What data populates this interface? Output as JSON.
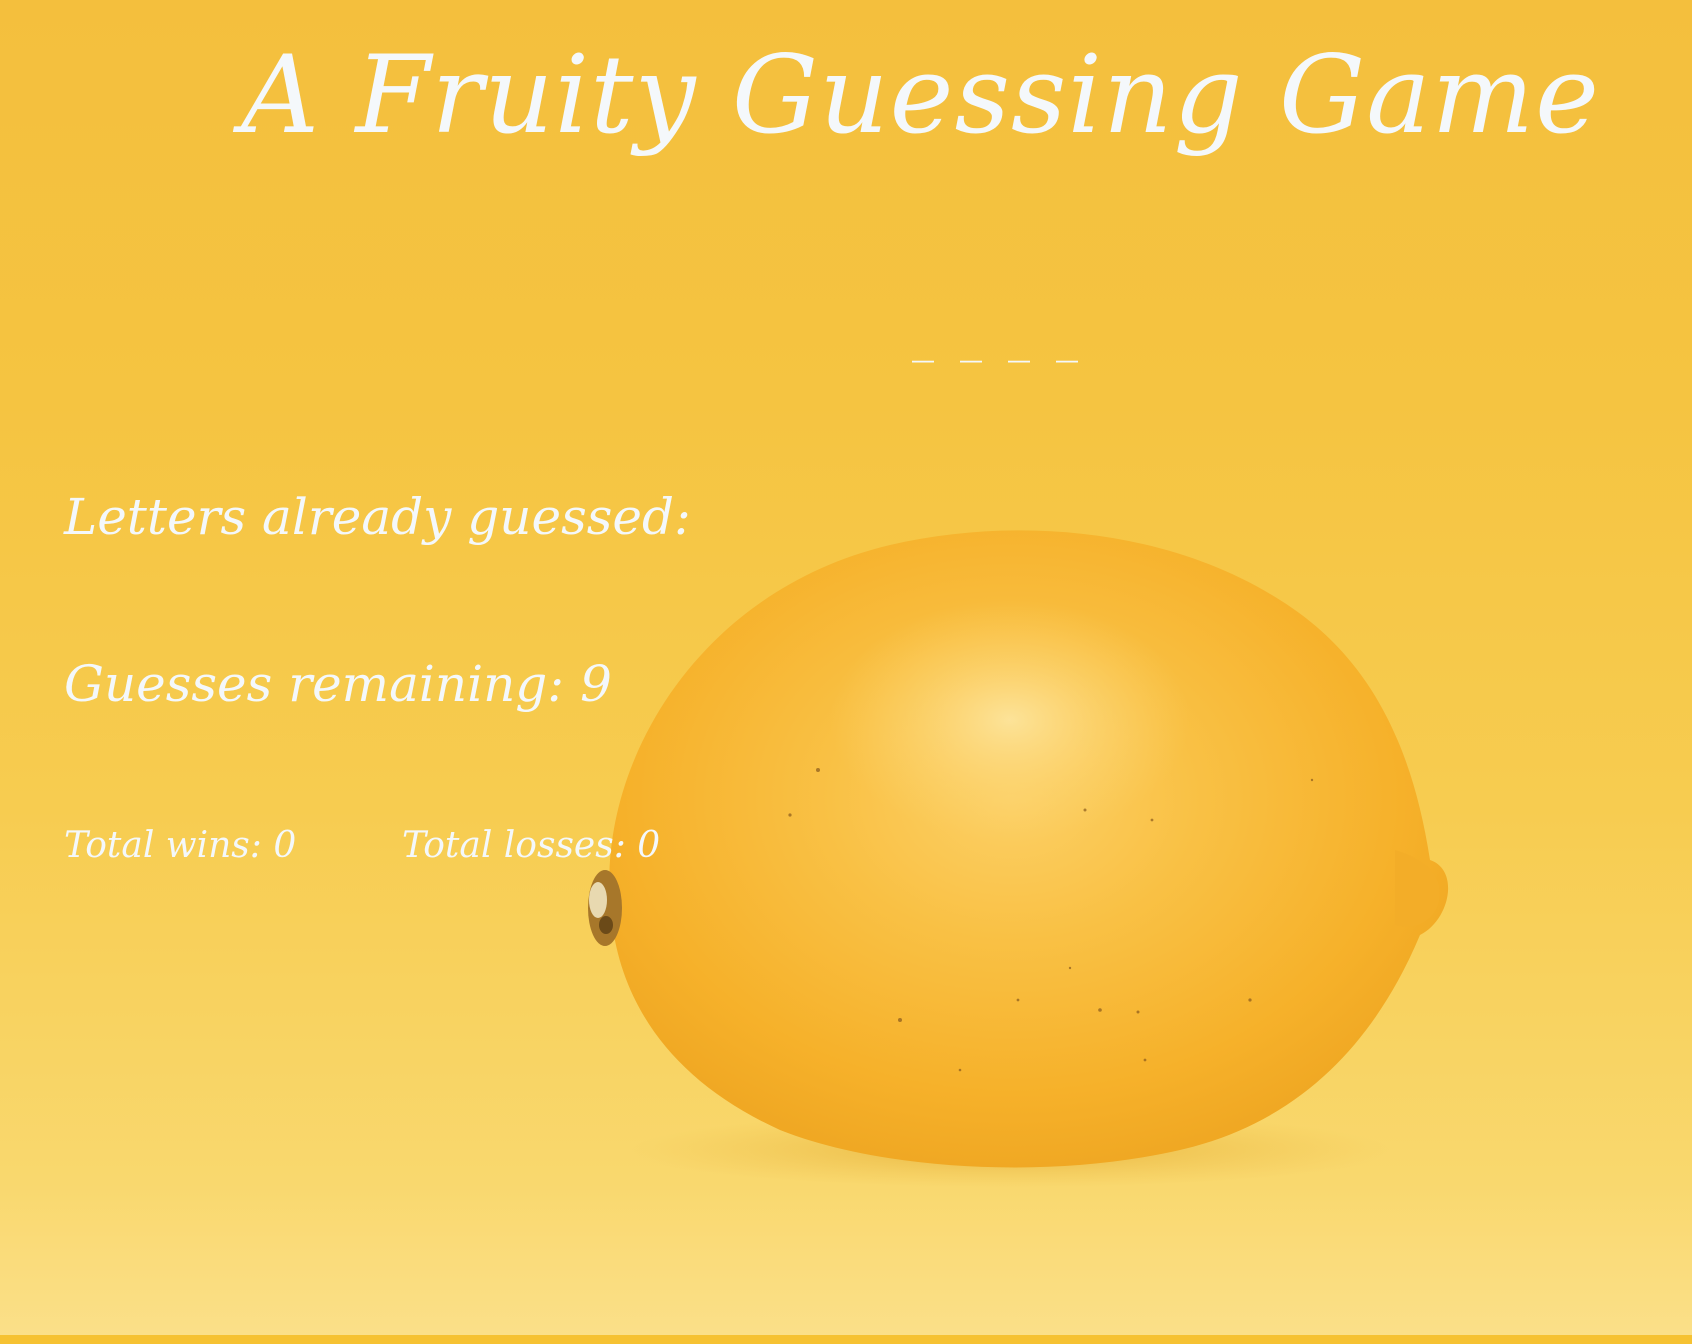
{
  "header": {
    "title": "A Fruity Guessing Game"
  },
  "game": {
    "word_display": "_ _ _ _",
    "letters_guessed_label": "Letters already guessed:",
    "letters_guessed_value": "",
    "guesses_remaining_label": "Guesses remaining:",
    "guesses_remaining_value": "9",
    "total_wins_label": "Total wins:",
    "total_wins_value": "0",
    "total_losses_label": "Total losses:",
    "total_losses_value": "0"
  },
  "background": {
    "image": "lemon-photo",
    "colors": {
      "backdrop_top": "#f4bf3d",
      "backdrop_bottom": "#fbe08a",
      "lemon": "#f7b82c",
      "text": "#f4f8fb"
    }
  }
}
